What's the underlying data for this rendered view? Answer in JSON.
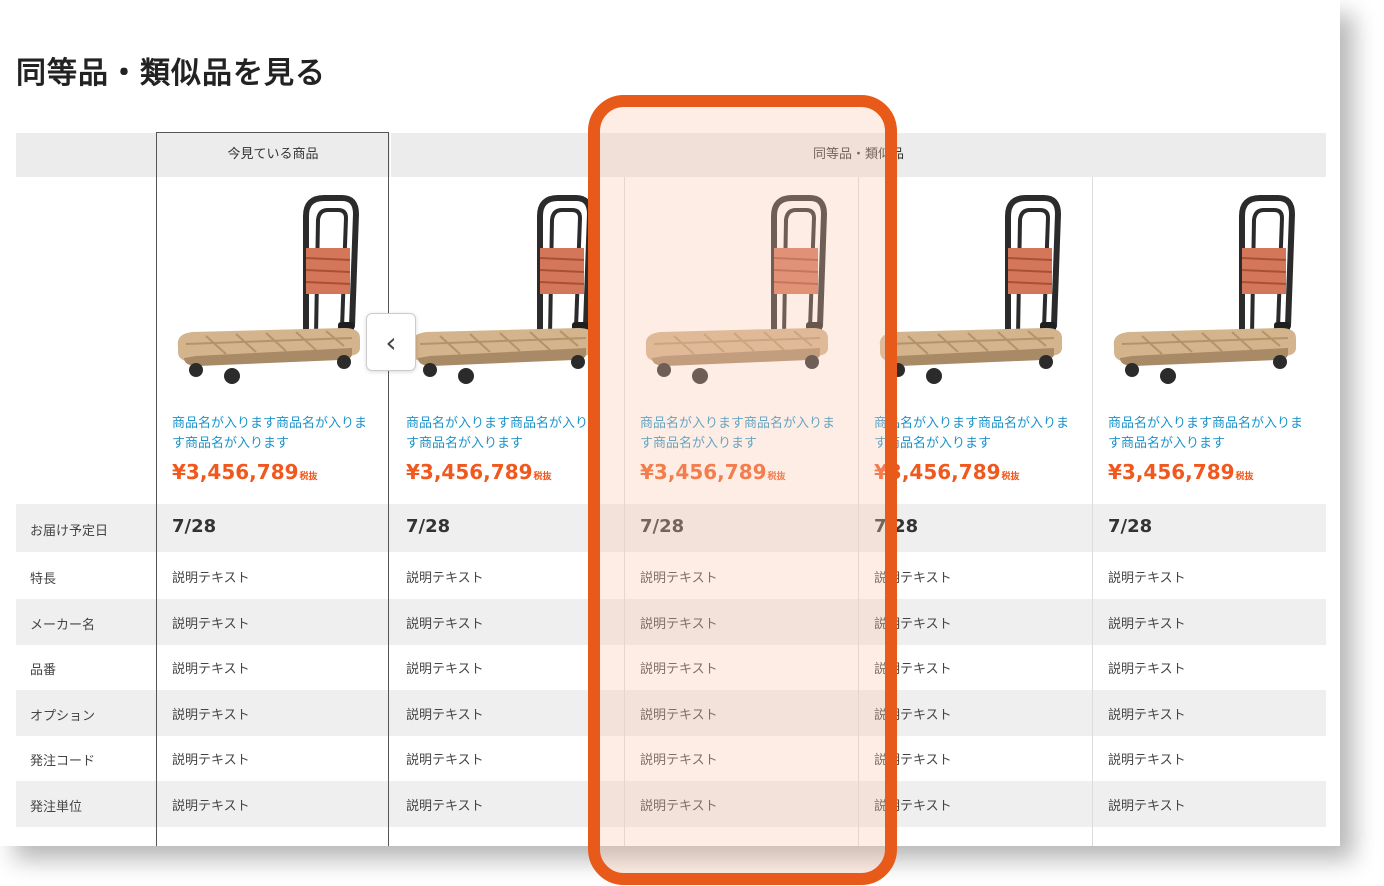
{
  "section_title": "同等品・類似品を見る",
  "current_group_label": "今見ている商品",
  "similar_group_label": "同等品・類似品",
  "prev_icon": "‹",
  "row_labels": [
    "お届け予定日",
    "特長",
    "メーカー名",
    "品番",
    "オプション",
    "発注コード",
    "発注単位"
  ],
  "products": [
    {
      "name": "商品名が入ります商品名が入ります商品名が入ります",
      "price": "¥3,456,789",
      "tax": "税抜",
      "date": "7/28",
      "details": [
        "説明テキスト",
        "説明テキスト",
        "説明テキスト",
        "説明テキスト",
        "説明テキスト",
        "説明テキスト"
      ]
    },
    {
      "name": "商品名が入ります商品名が入ります商品名が入ります",
      "price": "¥3,456,789",
      "tax": "税抜",
      "date": "7/28",
      "details": [
        "説明テキスト",
        "説明テキスト",
        "説明テキスト",
        "説明テキスト",
        "説明テキスト",
        "説明テキスト"
      ]
    },
    {
      "name": "商品名が入ります商品名が入ります商品名が入ります",
      "price": "¥3,456,789",
      "tax": "税抜",
      "date": "7/28",
      "details": [
        "説明テキスト",
        "説明テキスト",
        "説明テキスト",
        "説明テキスト",
        "説明テキスト",
        "説明テキスト"
      ]
    },
    {
      "name": "商品名が入ります商品名が入ります商品名が入ります",
      "price": "¥3,456,789",
      "tax": "税抜",
      "date": "7/28",
      "details": [
        "説明テキスト",
        "説明テキスト",
        "説明テキスト",
        "説明テキスト",
        "説明テキスト",
        "説明テキスト"
      ]
    },
    {
      "name": "商品名が入ります商品名が入ります商品名が入ります",
      "price": "¥3,456,789",
      "tax": "税抜",
      "date": "7/28",
      "details": [
        "説明テキスト",
        "説明テキスト",
        "説明テキスト",
        "説明テキスト",
        "説明テキスト",
        "説明テキスト"
      ]
    }
  ],
  "colors": {
    "highlight": "#e85a1a",
    "link": "#1d93c9",
    "price": "#f0581e",
    "band": "#efefef"
  },
  "icons": {
    "prev": "chevron-left-icon",
    "product_image": "platform-cart-icon"
  }
}
